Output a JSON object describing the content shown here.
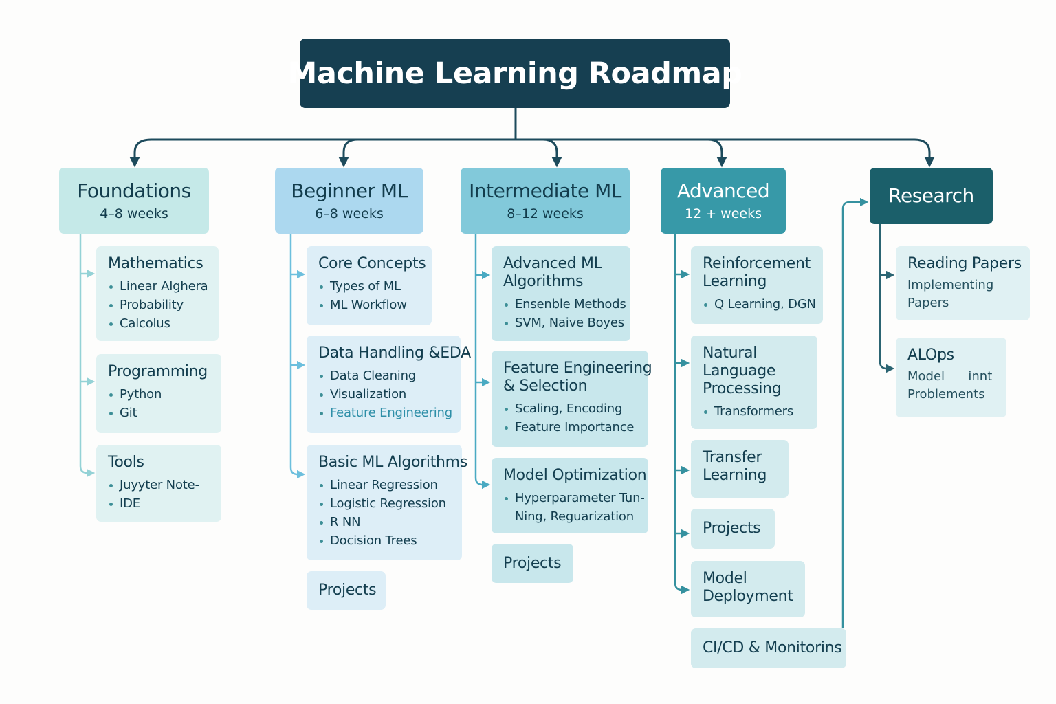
{
  "title": "Machine Learning Roadmap",
  "colors": {
    "title_bg": "#163f51",
    "foundations_bg": "#c5e9e8",
    "beginner_bg": "#acd8ef",
    "intermediate_bg": "#82c9da",
    "advanced_bg": "#3799a8",
    "research_bg": "#1b5f6a",
    "connector_dark": "#1d4b5c"
  },
  "phases": [
    {
      "title": "Foundations",
      "duration": "4–8 weeks",
      "cards": [
        {
          "title": [
            "Mathematics"
          ],
          "items": [
            "Linear Alghera",
            "Probability",
            "Calcolus"
          ]
        },
        {
          "title": [
            "Programming"
          ],
          "items": [
            "Python",
            "Git"
          ]
        },
        {
          "title": [
            "Tools"
          ],
          "items": [
            "Juyyter Note-",
            "IDE"
          ]
        }
      ]
    },
    {
      "title": "Beginner ML",
      "duration": "6–8 weeks",
      "cards": [
        {
          "title": [
            "Core Concepts"
          ],
          "items": [
            "Types of ML",
            "ML Workflow"
          ]
        },
        {
          "title": [
            "Data Handling &EDA"
          ],
          "items": [
            "Data Cleaning",
            "Visualization",
            "Feature Engineering"
          ]
        },
        {
          "title": [
            "Basic ML Algorithms"
          ],
          "items": [
            "Linear Regression",
            "Logistic Regression",
            "R NN",
            "Docision Trees"
          ]
        },
        {
          "title": [
            "Projects"
          ],
          "items": []
        }
      ]
    },
    {
      "title": "Intermediate ML",
      "duration": "8–12 weeks",
      "cards": [
        {
          "title": [
            "Advanced ML",
            "Algorithms"
          ],
          "items": [
            "Ensenble Methods",
            "SVM, Naive Boyes"
          ]
        },
        {
          "title": [
            "Feature Engineering",
            "& Selection"
          ],
          "items": [
            "Scaling, Encoding",
            "Feature Importance"
          ]
        },
        {
          "title": [
            "Model Optimization"
          ],
          "items": [
            "Hyperparameter Tun-"
          ],
          "item_continuation": "Ning, Reguarization"
        },
        {
          "title": [
            "Projects"
          ],
          "items": []
        }
      ]
    },
    {
      "title": "Advanced",
      "duration": "12 + weeks",
      "cards": [
        {
          "title": [
            "Reinforcement",
            "Learning"
          ],
          "items": [
            "Q Learning, DGN"
          ]
        },
        {
          "title": [
            "Natural",
            "Language",
            "Processing"
          ],
          "items": [
            "Transformers"
          ]
        },
        {
          "title": [
            "Transfer",
            "Learning"
          ],
          "items": []
        },
        {
          "title": [
            "Projects"
          ],
          "items": []
        },
        {
          "title": [
            "Model",
            "Deployment"
          ],
          "items": []
        },
        {
          "title": [
            "CI/CD & Monitorins"
          ],
          "items": []
        }
      ]
    },
    {
      "title": "Research",
      "duration": "",
      "cards": [
        {
          "title": [
            "Reading Papers"
          ],
          "note": [
            "Implementing",
            "Papers"
          ]
        },
        {
          "title": [
            "ALOps"
          ],
          "note": [
            "Model      innt",
            "Problements"
          ]
        }
      ]
    }
  ]
}
